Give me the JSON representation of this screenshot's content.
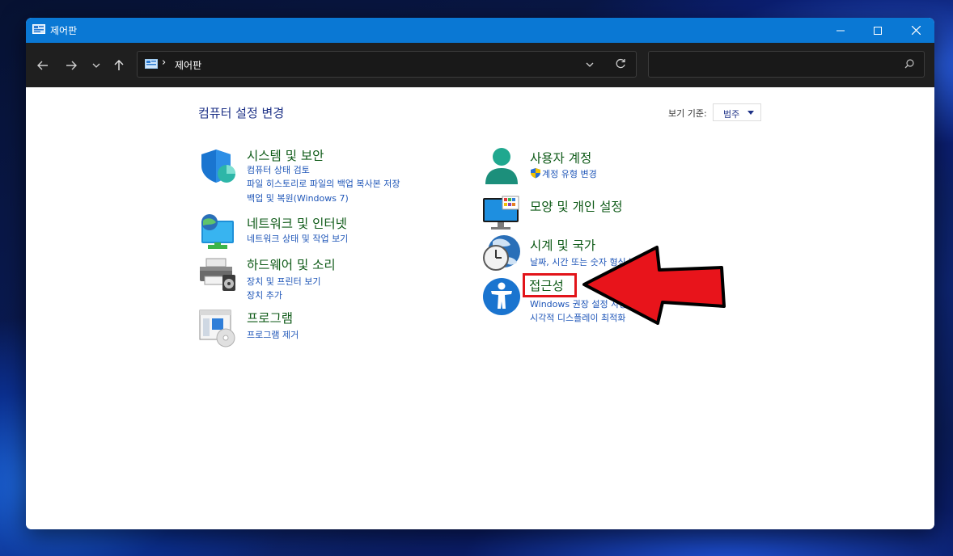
{
  "window": {
    "title": "제어판",
    "controls": [
      "minimize",
      "maximize",
      "close"
    ]
  },
  "toolbar": {
    "nav": [
      "back-icon",
      "forward-icon",
      "recent-dropdown-icon",
      "up-icon"
    ],
    "breadcrumb": "제어판",
    "search_placeholder": ""
  },
  "main": {
    "title": "컴퓨터 설정 변경",
    "view_by_label": "보기 기준:",
    "view_by_value": "범주"
  },
  "categories": [
    {
      "heading": "시스템 및 보안",
      "icon": "shield-icon",
      "links": [
        "컴퓨터 상태 검토",
        "파일 히스토리로 파일의 백업 복사본 저장",
        "백업 및 복원(Windows 7)"
      ]
    },
    {
      "heading": "네트워크 및 인터넷",
      "icon": "network-icon",
      "links": [
        "네트워크 상태 및 작업 보기"
      ]
    },
    {
      "heading": "하드웨어 및 소리",
      "icon": "printer-icon",
      "links": [
        "장치 및 프린터 보기",
        "장치 추가"
      ]
    },
    {
      "heading": "프로그램",
      "icon": "programs-icon",
      "links": [
        "프로그램 제거"
      ]
    },
    {
      "heading": "사용자 계정",
      "icon": "user-icon",
      "links": [
        "계정 유형 변경"
      ]
    },
    {
      "heading": "모양 및 개인 설정",
      "icon": "monitor-icon",
      "links": []
    },
    {
      "heading": "시계 및 국가",
      "icon": "clock-globe-icon",
      "links": [
        "날짜, 시간 또는 숫자 형식 변경"
      ]
    },
    {
      "heading": "접근성",
      "icon": "accessibility-icon",
      "links": [
        "Windows 권장 설정 사용",
        "시각적 디스플레이 최적화"
      ]
    }
  ],
  "colors": {
    "titlebar": "#0a78d4",
    "heading_green": "#0e5a17",
    "link_blue": "#1f56b8",
    "highlight_red": "#e2141a"
  }
}
